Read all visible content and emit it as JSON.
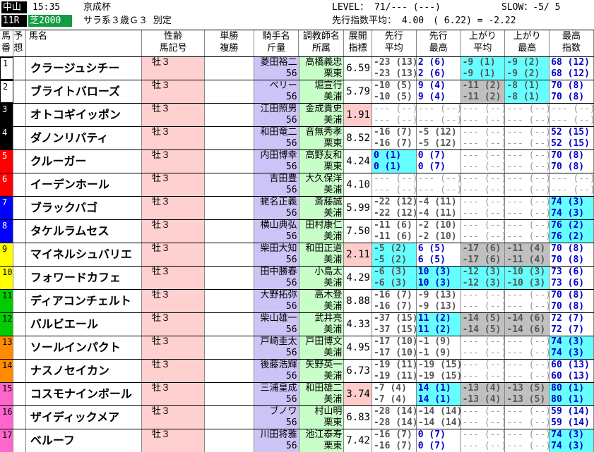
{
  "header": {
    "venue": "中山",
    "time": "15:35",
    "race_name": "京成杯",
    "race_number": "11R",
    "course": "芝2000",
    "race_class": "サラ系３歳Ｇ３ 別定",
    "level": "LEVEL： 71/--- (---)",
    "slow": "SLOW：-5/ 5",
    "pace": "先行指数平均： 4.00　( 6.22) = -2.22"
  },
  "columns": {
    "num": [
      "馬",
      "番"
    ],
    "pred": [
      "予",
      "想"
    ],
    "horse": "馬名",
    "sex": [
      "性齢",
      "馬記号"
    ],
    "odds": [
      "単勝",
      "複勝"
    ],
    "jockey": [
      "騎手名",
      "斤量"
    ],
    "trainer": [
      "調教師名",
      "所属"
    ],
    "idx": [
      "展開",
      "指標"
    ],
    "p1": [
      "先行",
      "平均"
    ],
    "p2": [
      "先行",
      "最高"
    ],
    "p3": [
      "上がり",
      "平均"
    ],
    "p4": [
      "上がり",
      "最高"
    ],
    "p5": [
      "最高",
      "指数"
    ]
  },
  "colors": {
    "frame": [
      "#ffffff",
      "#000000",
      "#ff0000",
      "#0000ff",
      "#ffff00",
      "#00cc00",
      "#ff8c00",
      "#ff66cc"
    ],
    "idx_pink": "#ffcccc",
    "cyan": "#66ffff",
    "grey": "#c0c0c0"
  },
  "horses": [
    {
      "num": "1",
      "frame": 0,
      "name": "クラージュシチー",
      "sex": "牡３",
      "jockey": "菱田裕二",
      "weight": "56",
      "trainer": "高橋義忠",
      "belong": "栗東",
      "idx": "6.59",
      "idxhi": false,
      "p1": [
        "-23 (13)",
        "-23 (13)"
      ],
      "p2": [
        "2 (6)",
        "2 (6)"
      ],
      "p3": [
        "-9 (1)",
        "-9 (1)"
      ],
      "p4": [
        "-9 (2)",
        "-9 (2)"
      ],
      "p5": [
        "68 (12)",
        "68 (12)"
      ],
      "c1": "",
      "c2": "",
      "c3": "cyan",
      "c4": "cyan",
      "c5": ""
    },
    {
      "num": "2",
      "frame": 0,
      "name": "ブライトバローズ",
      "sex": "牡３",
      "jockey": "ベリー",
      "weight": "56",
      "trainer": "堀宣行",
      "belong": "美浦",
      "idx": "5.79",
      "idxhi": false,
      "p1": [
        "-10 (5)",
        "-10 (5)"
      ],
      "p2": [
        "9 (4)",
        "9 (4)"
      ],
      "p3": [
        "-11 (2)",
        "-11 (2)"
      ],
      "p4": [
        "-8 (1)",
        "-8 (1)"
      ],
      "p5": [
        "70 (8)",
        "70 (8)"
      ],
      "c1": "",
      "c2": "",
      "c3": "",
      "c4": "cyan",
      "c5": ""
    },
    {
      "num": "3",
      "frame": 1,
      "name": "オトコギイッポン",
      "sex": "牡３",
      "jockey": "江田照男",
      "weight": "56",
      "trainer": "金成貴史",
      "belong": "美浦",
      "idx": "1.91",
      "idxhi": true,
      "p1": [
        "--- (--)",
        "--- (--)"
      ],
      "p2": [
        "--- (--)",
        "--- (--)"
      ],
      "p3": [
        "--- (--)",
        "--- (--)"
      ],
      "p4": [
        "--- (--)",
        "--- (--)"
      ],
      "p5": [
        "--- (--)",
        "--- (--)"
      ],
      "c1": "",
      "c2": "",
      "c3": "",
      "c4": "",
      "c5": ""
    },
    {
      "num": "4",
      "frame": 1,
      "name": "ダノンリバティ",
      "sex": "牡３",
      "jockey": "和田竜二",
      "weight": "56",
      "trainer": "音無秀孝",
      "belong": "栗東",
      "idx": "8.52",
      "idxhi": false,
      "p1": [
        "-16 (7)",
        "-16 (7)"
      ],
      "p2": [
        "-5 (12)",
        "-5 (12)"
      ],
      "p3": [
        "--- (--)",
        "--- (--)"
      ],
      "p4": [
        "--- (--)",
        "--- (--)"
      ],
      "p5": [
        "52 (15)",
        "52 (15)"
      ],
      "c1": "",
      "c2": "",
      "c3": "",
      "c4": "",
      "c5": ""
    },
    {
      "num": "5",
      "frame": 2,
      "name": "クルーガー",
      "sex": "牡３",
      "jockey": "内田博幸",
      "weight": "56",
      "trainer": "高野友和",
      "belong": "栗東",
      "idx": "4.24",
      "idxhi": false,
      "p1": [
        "0 (1)",
        "0 (1)"
      ],
      "p2": [
        "0 (7)",
        "0 (7)"
      ],
      "p3": [
        "--- (--)",
        "--- (--)"
      ],
      "p4": [
        "--- (--)",
        "--- (--)"
      ],
      "p5": [
        "70 (8)",
        "70 (8)"
      ],
      "c1": "cyan",
      "c2": "",
      "c3": "",
      "c4": "",
      "c5": ""
    },
    {
      "num": "6",
      "frame": 2,
      "name": "イーデンホール",
      "sex": "牡３",
      "jockey": "吉田豊",
      "weight": "56",
      "trainer": "大久保洋",
      "belong": "美浦",
      "idx": "4.10",
      "idxhi": false,
      "p1": [
        "--- (--)",
        "--- (--)"
      ],
      "p2": [
        "--- (--)",
        "--- (--)"
      ],
      "p3": [
        "--- (--)",
        "--- (--)"
      ],
      "p4": [
        "--- (--)",
        "--- (--)"
      ],
      "p5": [
        "--- (--)",
        "--- (--)"
      ],
      "c1": "",
      "c2": "",
      "c3": "",
      "c4": "",
      "c5": ""
    },
    {
      "num": "7",
      "frame": 3,
      "name": "ブラックバゴ",
      "sex": "牡３",
      "jockey": "蛯名正義",
      "weight": "56",
      "trainer": "斎藤誠",
      "belong": "美浦",
      "idx": "5.99",
      "idxhi": false,
      "p1": [
        "-22 (12)",
        "-22 (12)"
      ],
      "p2": [
        "-4 (11)",
        "-4 (11)"
      ],
      "p3": [
        "--- (--)",
        "--- (--)"
      ],
      "p4": [
        "--- (--)",
        "--- (--)"
      ],
      "p5": [
        "74 (3)",
        "74 (3)"
      ],
      "c1": "",
      "c2": "",
      "c3": "",
      "c4": "",
      "c5": "cyan"
    },
    {
      "num": "8",
      "frame": 3,
      "name": "タケルラムセス",
      "sex": "牡３",
      "jockey": "横山典弘",
      "weight": "56",
      "trainer": "田村康仁",
      "belong": "美浦",
      "idx": "7.50",
      "idxhi": false,
      "p1": [
        "-11 (6)",
        "-11 (6)"
      ],
      "p2": [
        "-2 (10)",
        "-2 (10)"
      ],
      "p3": [
        "--- (--)",
        "--- (--)"
      ],
      "p4": [
        "--- (--)",
        "--- (--)"
      ],
      "p5": [
        "76 (2)",
        "76 (2)"
      ],
      "c1": "",
      "c2": "",
      "c3": "",
      "c4": "",
      "c5": "cyan"
    },
    {
      "num": "9",
      "frame": 4,
      "name": "マイネルシュバリエ",
      "sex": "牡３",
      "jockey": "柴田大知",
      "weight": "56",
      "trainer": "和田正道",
      "belong": "美浦",
      "idx": "2.11",
      "idxhi": true,
      "p1": [
        "-5 (2)",
        "-5 (2)"
      ],
      "p2": [
        "6 (5)",
        "6 (5)"
      ],
      "p3": [
        "-17 (6)",
        "-17 (6)"
      ],
      "p4": [
        "-11 (4)",
        "-11 (4)"
      ],
      "p5": [
        "70 (8)",
        "70 (8)"
      ],
      "c1": "cyan",
      "c2": "",
      "c3": "",
      "c4": "",
      "c5": ""
    },
    {
      "num": "10",
      "frame": 4,
      "name": "フォワードカフェ",
      "sex": "牡３",
      "jockey": "田中勝春",
      "weight": "56",
      "trainer": "小島太",
      "belong": "美浦",
      "idx": "4.29",
      "idxhi": false,
      "p1": [
        "-6 (3)",
        "-6 (3)"
      ],
      "p2": [
        "10 (3)",
        "10 (3)"
      ],
      "p3": [
        "-12 (3)",
        "-12 (3)"
      ],
      "p4": [
        "-10 (3)",
        "-10 (3)"
      ],
      "p5": [
        "73 (6)",
        "73 (6)"
      ],
      "c1": "cyan",
      "c2": "cyan",
      "c3": "cyan",
      "c4": "cyan",
      "c5": ""
    },
    {
      "num": "11",
      "frame": 5,
      "name": "ディアコンチェルト",
      "sex": "牡３",
      "jockey": "大野拓弥",
      "weight": "56",
      "trainer": "高木登",
      "belong": "美浦",
      "idx": "8.88",
      "idxhi": false,
      "p1": [
        "-16 (7)",
        "-16 (7)"
      ],
      "p2": [
        "-9 (13)",
        "-9 (13)"
      ],
      "p3": [
        "--- (--)",
        "--- (--)"
      ],
      "p4": [
        "--- (--)",
        "--- (--)"
      ],
      "p5": [
        "70 (8)",
        "70 (8)"
      ],
      "c1": "",
      "c2": "",
      "c3": "",
      "c4": "",
      "c5": ""
    },
    {
      "num": "12",
      "frame": 5,
      "name": "バルビエール",
      "sex": "牡３",
      "jockey": "柴山雄一",
      "weight": "56",
      "trainer": "武井亮",
      "belong": "美浦",
      "idx": "4.33",
      "idxhi": false,
      "p1": [
        "-37 (15)",
        "-37 (15)"
      ],
      "p2": [
        "11 (2)",
        "11 (2)"
      ],
      "p3": [
        "-14 (5)",
        "-14 (5)"
      ],
      "p4": [
        "-14 (6)",
        "-14 (6)"
      ],
      "p5": [
        "72 (7)",
        "72 (7)"
      ],
      "c1": "",
      "c2": "cyan",
      "c3": "",
      "c4": "",
      "c5": ""
    },
    {
      "num": "13",
      "frame": 6,
      "name": "ソールインパクト",
      "sex": "牡３",
      "jockey": "戸崎圭太",
      "weight": "56",
      "trainer": "戸田博文",
      "belong": "美浦",
      "idx": "4.95",
      "idxhi": false,
      "p1": [
        "-17 (10)",
        "-17 (10)"
      ],
      "p2": [
        "-1 (9)",
        "-1 (9)"
      ],
      "p3": [
        "--- (--)",
        "--- (--)"
      ],
      "p4": [
        "--- (--)",
        "--- (--)"
      ],
      "p5": [
        "74 (3)",
        "74 (3)"
      ],
      "c1": "",
      "c2": "",
      "c3": "",
      "c4": "",
      "c5": "cyan"
    },
    {
      "num": "14",
      "frame": 6,
      "name": "ナスノセイカン",
      "sex": "牡３",
      "jockey": "後藤浩輝",
      "weight": "56",
      "trainer": "矢野英一",
      "belong": "美浦",
      "idx": "6.73",
      "idxhi": false,
      "p1": [
        "-19 (11)",
        "-19 (11)"
      ],
      "p2": [
        "-19 (15)",
        "-19 (15)"
      ],
      "p3": [
        "--- (--)",
        "--- (--)"
      ],
      "p4": [
        "--- (--)",
        "--- (--)"
      ],
      "p5": [
        "60 (13)",
        "60 (13)"
      ],
      "c1": "",
      "c2": "",
      "c3": "",
      "c4": "",
      "c5": ""
    },
    {
      "num": "15",
      "frame": 7,
      "name": "コスモナインボール",
      "sex": "牡３",
      "jockey": "三浦皇成",
      "weight": "56",
      "trainer": "和田雄二",
      "belong": "美浦",
      "idx": "3.74",
      "idxhi": true,
      "p1": [
        "-7 (4)",
        "-7 (4)"
      ],
      "p2": [
        "14 (1)",
        "14 (1)"
      ],
      "p3": [
        "-13 (4)",
        "-13 (4)"
      ],
      "p4": [
        "-13 (5)",
        "-13 (5)"
      ],
      "p5": [
        "80 (1)",
        "80 (1)"
      ],
      "c1": "",
      "c2": "cyan",
      "c3": "",
      "c4": "",
      "c5": "cyan"
    },
    {
      "num": "16",
      "frame": 7,
      "name": "ザイディックメア",
      "sex": "牡３",
      "jockey": "ブノワ",
      "weight": "56",
      "trainer": "村山明",
      "belong": "栗東",
      "idx": "6.83",
      "idxhi": false,
      "p1": [
        "-28 (14)",
        "-28 (14)"
      ],
      "p2": [
        "-14 (14)",
        "-14 (14)"
      ],
      "p3": [
        "--- (--)",
        "--- (--)"
      ],
      "p4": [
        "--- (--)",
        "--- (--)"
      ],
      "p5": [
        "59 (14)",
        "59 (14)"
      ],
      "c1": "",
      "c2": "",
      "c3": "",
      "c4": "",
      "c5": ""
    },
    {
      "num": "17",
      "frame": 7,
      "name": "ベルーフ",
      "sex": "牡３",
      "jockey": "川田将雅",
      "weight": "56",
      "trainer": "池江泰寿",
      "belong": "栗東",
      "idx": "7.42",
      "idxhi": false,
      "p1": [
        "-16 (7)",
        "-16 (7)"
      ],
      "p2": [
        "0 (7)",
        "0 (7)"
      ],
      "p3": [
        "--- (--)",
        "--- (--)"
      ],
      "p4": [
        "--- (--)",
        "--- (--)"
      ],
      "p5": [
        "74 (3)",
        "74 (3)"
      ],
      "c1": "",
      "c2": "",
      "c3": "",
      "c4": "",
      "c5": "cyan"
    }
  ]
}
